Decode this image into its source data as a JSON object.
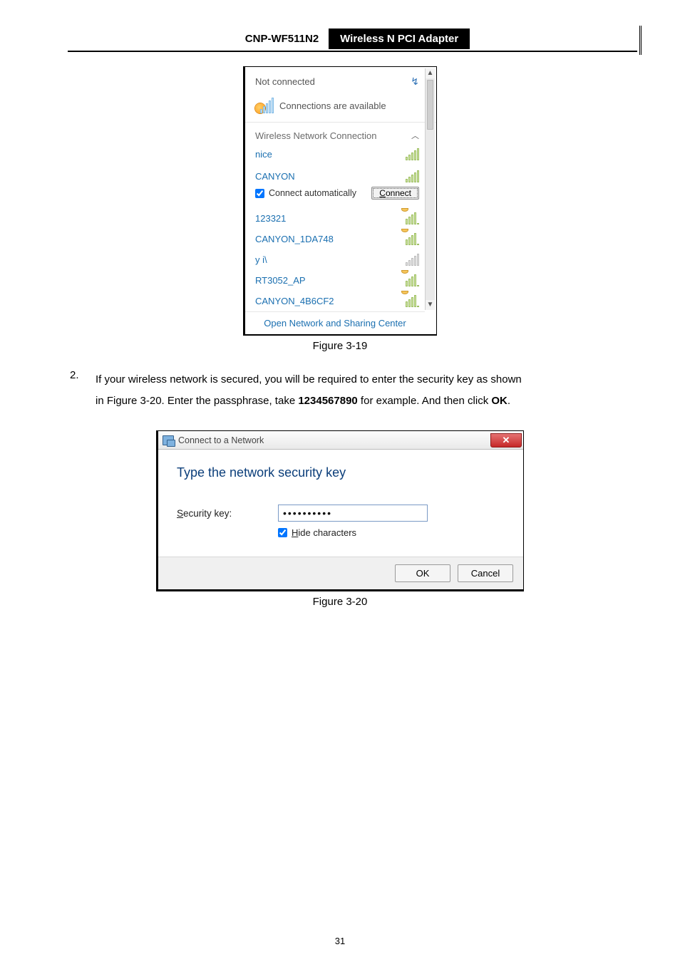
{
  "header": {
    "model": "CNP-WF511N2",
    "title": "Wireless N PCI Adapter"
  },
  "flyout": {
    "status": "Not connected",
    "avail": "Connections are available",
    "section_label": "Wireless Network Connection",
    "auto_label": "Connect automatically",
    "connect_btn": "Connect",
    "footer": "Open Network and Sharing Center",
    "selected": {
      "name": "CANYON"
    },
    "networks_pre": [
      {
        "name": "nice"
      }
    ],
    "networks_post": [
      {
        "name": "123321"
      },
      {
        "name": "CANYON_1DA748"
      },
      {
        "name": "у і\\"
      },
      {
        "name": "RT3052_AP"
      },
      {
        "name": "CANYON_4B6CF2"
      }
    ]
  },
  "fig1_caption": "Figure 3-19",
  "step": {
    "num": "2.",
    "line1a": "If your wireless network is secured, you will be required to enter the security key as shown",
    "line2a": "in Figure 3-20. Enter the passphrase, take ",
    "line2b": "1234567890",
    "line2c": " for example. And then click ",
    "line2d": "OK",
    "line2e": "."
  },
  "dialog": {
    "title": "Connect to a Network",
    "heading": "Type the network security key",
    "field_label_pre": "S",
    "field_label_post": "ecurity key:",
    "password_mask": "••••••••••",
    "hide_pre": "H",
    "hide_post": "ide characters",
    "ok": "OK",
    "cancel": "Cancel"
  },
  "fig2_caption": "Figure 3-20",
  "page_number": "31"
}
